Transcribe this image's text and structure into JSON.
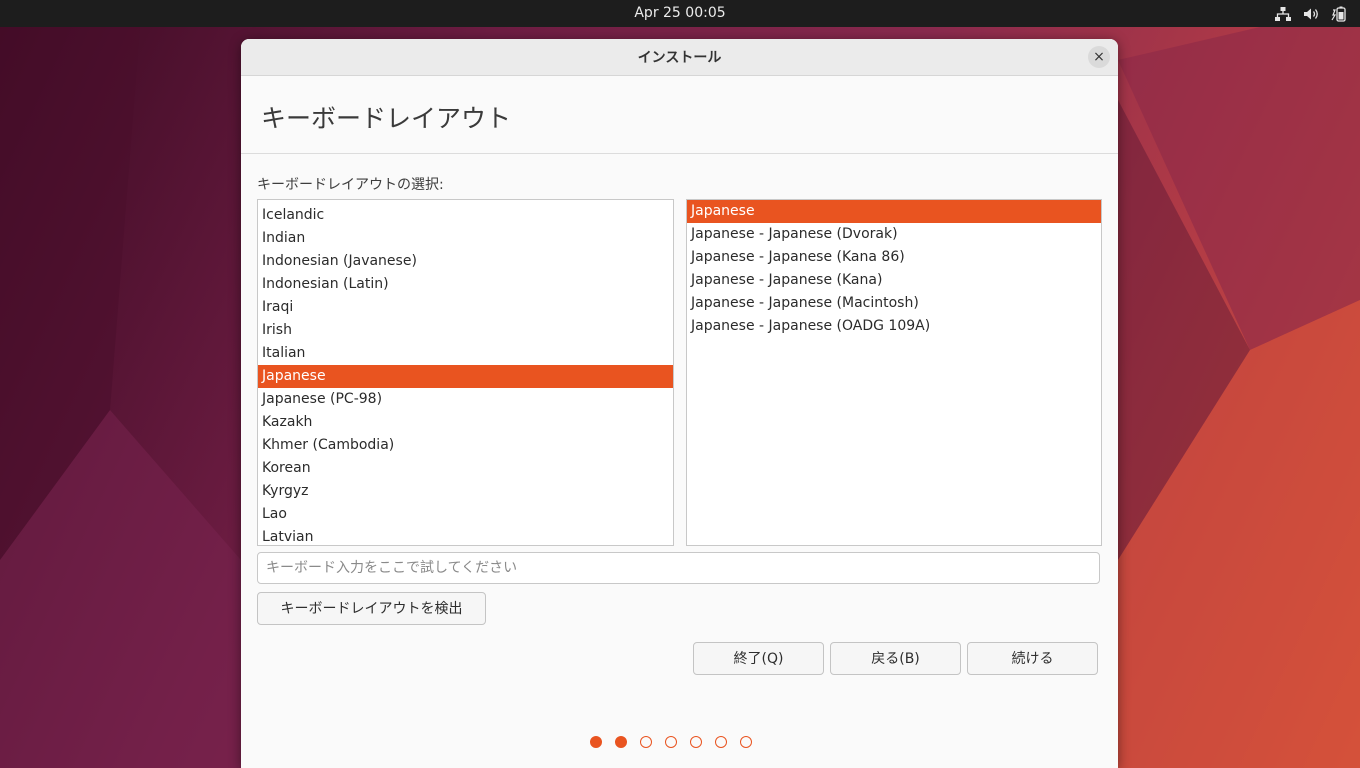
{
  "topbar": {
    "clock": "Apr 25  00:05",
    "tray_icons": [
      "network-icon",
      "volume-icon",
      "battery-icon"
    ]
  },
  "window": {
    "title": "インストール",
    "close_label": "×"
  },
  "page": {
    "heading": "キーボードレイアウト",
    "select_label": "キーボードレイアウトの選択:"
  },
  "layouts": {
    "items": [
      "Icelandic",
      "Indian",
      "Indonesian (Javanese)",
      "Indonesian (Latin)",
      "Iraqi",
      "Irish",
      "Italian",
      "Japanese",
      "Japanese (PC-98)",
      "Kazakh",
      "Khmer (Cambodia)",
      "Korean",
      "Kyrgyz",
      "Lao",
      "Latvian"
    ],
    "selected": "Japanese"
  },
  "variants": {
    "items": [
      "Japanese",
      "Japanese - Japanese (Dvorak)",
      "Japanese - Japanese (Kana 86)",
      "Japanese - Japanese (Kana)",
      "Japanese - Japanese (Macintosh)",
      "Japanese - Japanese (OADG 109A)"
    ],
    "selected": "Japanese"
  },
  "test_input": {
    "placeholder": "キーボード入力をここで試してください",
    "value": ""
  },
  "buttons": {
    "detect": "キーボードレイアウトを検出",
    "quit": "終了(Q)",
    "back": "戻る(B)",
    "continue": "続ける"
  },
  "progress": {
    "total_steps": 7,
    "completed_steps": 2
  },
  "colors": {
    "accent": "#e95420",
    "topbar": "#1d1d1d"
  }
}
